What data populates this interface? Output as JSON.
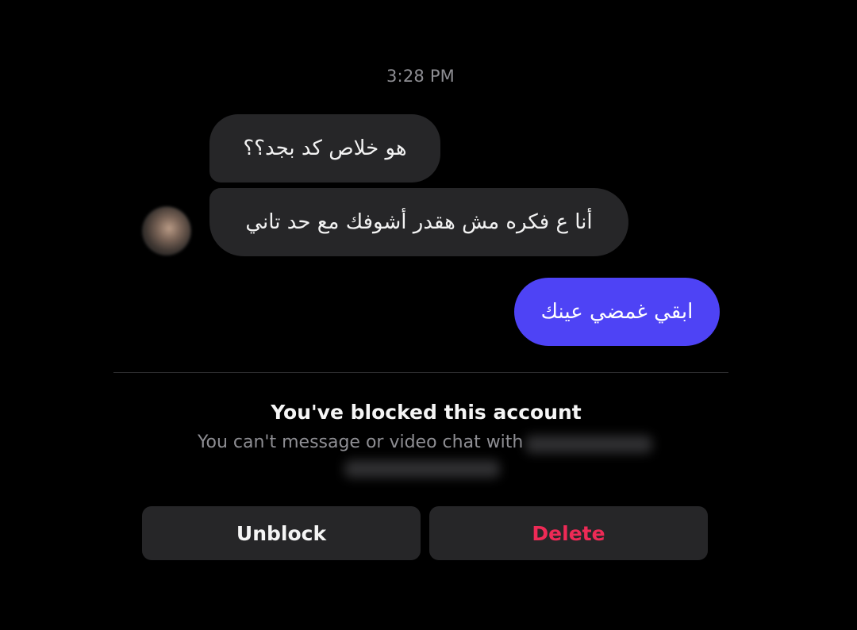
{
  "conversation": {
    "timestamp": "3:28 PM",
    "messages": [
      {
        "sender": "them",
        "text": "هو خلاص كد بجد؟؟"
      },
      {
        "sender": "them",
        "text": "أنا ع فكره مش هقدر أشوفك مع حد تاني"
      },
      {
        "sender": "me",
        "text": "ابقي غمضي عينك"
      }
    ]
  },
  "blocked_notice": {
    "title": "You've blocked this account",
    "subtitle": "You can't message or video chat with"
  },
  "actions": {
    "unblock_label": "Unblock",
    "delete_label": "Delete"
  },
  "colors": {
    "background": "#000000",
    "incoming_bubble": "#262628",
    "outgoing_bubble": "#4e43f5",
    "delete_text": "#ee2a56",
    "muted_text": "#8e8e93"
  }
}
